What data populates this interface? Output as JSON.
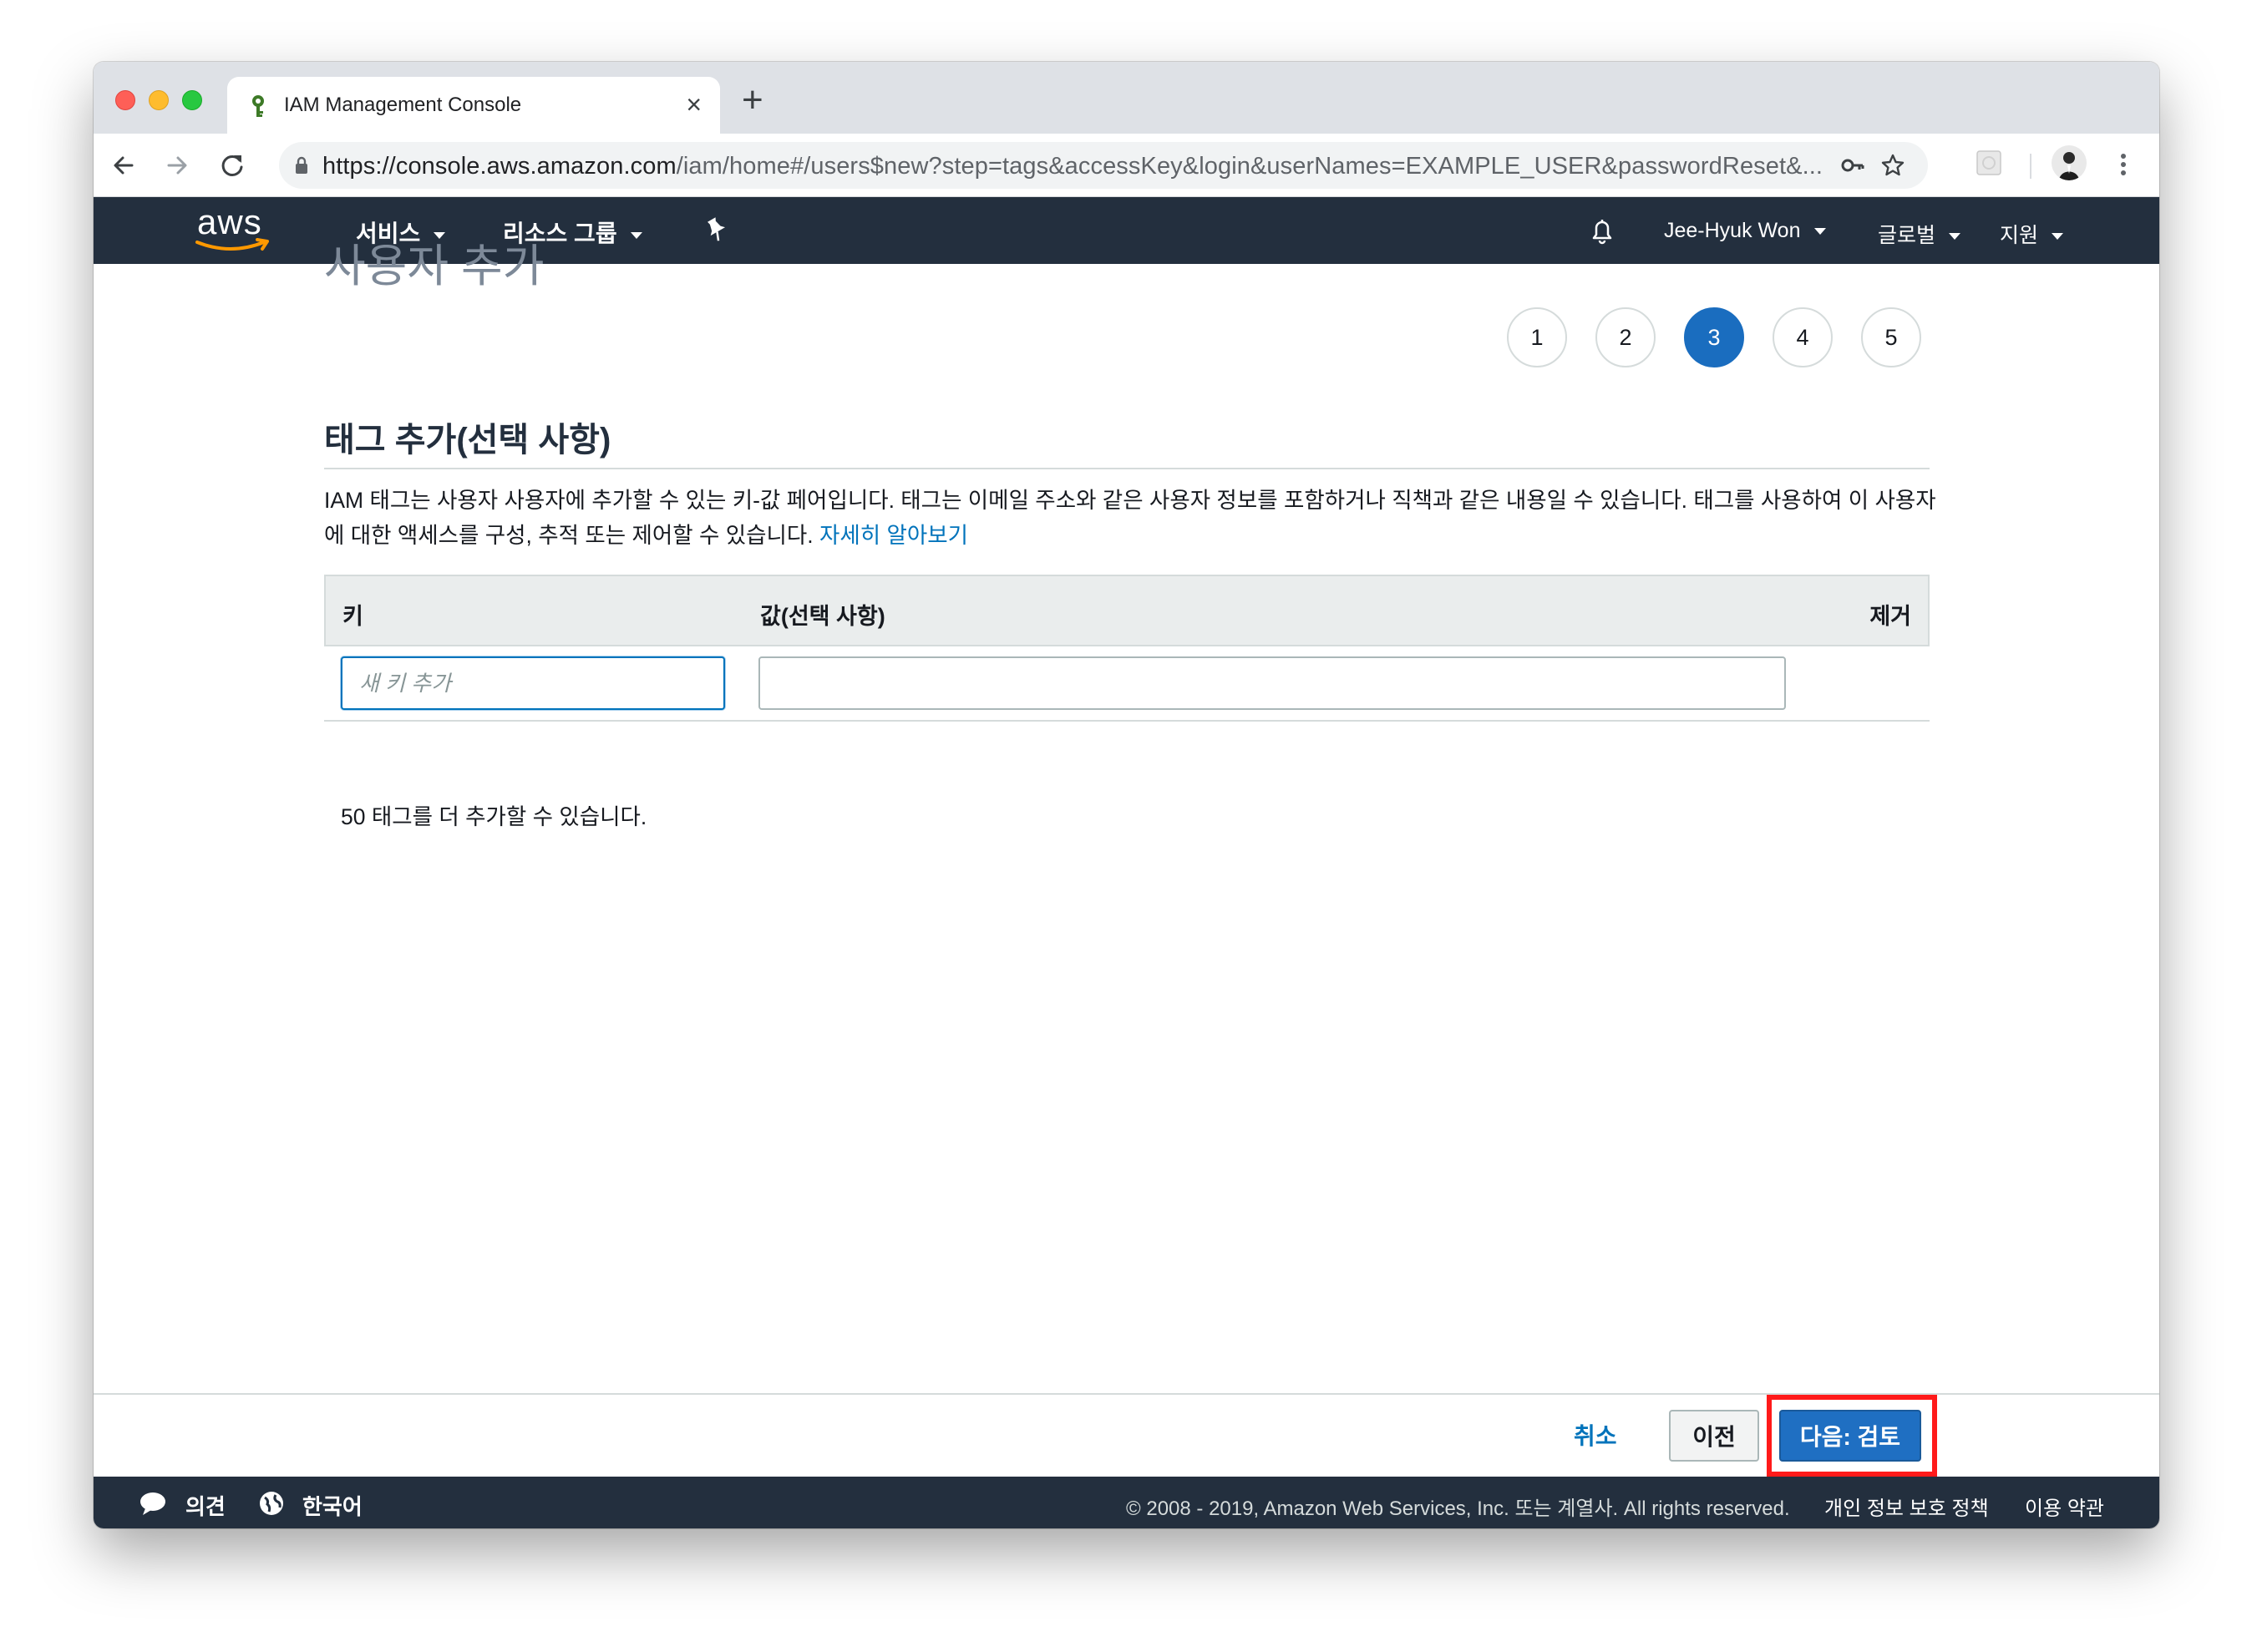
{
  "browser": {
    "tab_title": "IAM Management Console",
    "tab_close": "×",
    "new_tab": "+",
    "url_host": "https://console.aws.amazon.com",
    "url_path": "/iam/home#/users$new?step=tags&accessKey&login&userNames=EXAMPLE_USER&passwordReset&..."
  },
  "aws_nav": {
    "logo_text": "aws",
    "services": "서비스",
    "resource_groups": "리소스 그룹",
    "user": "Jee-Hyuk Won",
    "region": "글로벌",
    "support": "지원"
  },
  "page": {
    "title": "사용자 추가",
    "steps": [
      "1",
      "2",
      "3",
      "4",
      "5"
    ],
    "active_step": "3",
    "section_title": "태그 추가(선택 사항)",
    "description": "IAM 태그는 사용자 사용자에 추가할 수 있는 키-값 페어입니다. 태그는 이메일 주소와 같은 사용자 정보를 포함하거나 직책과 같은 내용일 수 있습니다. 태그를 사용하여 이 사용자에 대한 액세스를 구성, 추적 또는 제어할 수 있습니다.",
    "learn_more": "자세히 알아보기"
  },
  "tag_table": {
    "col_key": "키",
    "col_value": "값(선택 사항)",
    "col_remove": "제거",
    "key_placeholder": "새 키 추가",
    "key_value": "",
    "value_value": "",
    "remaining": "50 태그를 더 추가할 수 있습니다."
  },
  "wizard_footer": {
    "cancel": "취소",
    "previous": "이전",
    "next": "다음: 검토"
  },
  "console_footer": {
    "feedback": "의견",
    "language": "한국어",
    "copyright": "© 2008 - 2019, Amazon Web Services, Inc. 또는 계열사. All rights reserved.",
    "privacy": "개인 정보 보호 정책",
    "terms": "이용 약관"
  },
  "colors": {
    "aws_nav_bg": "#232f3e",
    "primary_button": "#1f6fc2",
    "active_step": "#1a6dbf",
    "link": "#0073bb",
    "highlight": "#ff1a1a"
  }
}
